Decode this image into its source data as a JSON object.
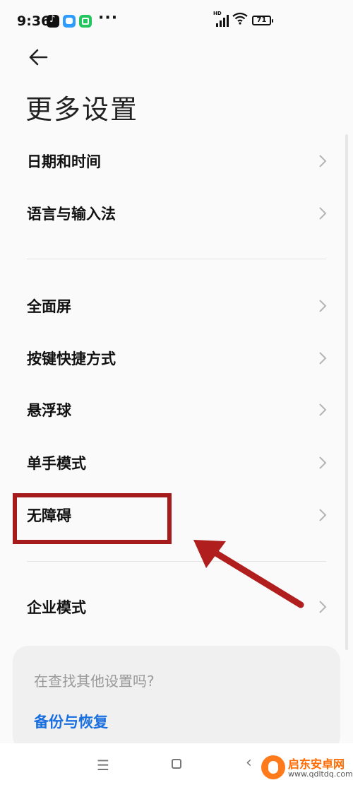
{
  "status_bar": {
    "time": "9:36",
    "more": "···",
    "network_badge": "HD",
    "battery": "71"
  },
  "header": {
    "title": "更多设置"
  },
  "settings": {
    "group1": [
      {
        "label": "日期和时间"
      },
      {
        "label": "语言与输入法"
      }
    ],
    "group2": [
      {
        "label": "全面屏"
      },
      {
        "label": "按键快捷方式"
      },
      {
        "label": "悬浮球"
      },
      {
        "label": "单手模式"
      },
      {
        "label": "无障碍"
      }
    ],
    "group3": [
      {
        "label": "企业模式"
      }
    ]
  },
  "search_card": {
    "question": "在查找其他设置吗?",
    "link": "备份与恢复"
  },
  "nav_bar": {
    "menu_glyph": "☰",
    "back_glyph": "‹"
  },
  "watermark": {
    "name": "启东安卓网",
    "url": "www.qdltdq.com"
  },
  "icons": {
    "back": "arrow-left-icon",
    "chevron": "chevron-right-icon",
    "annotation": "red-arrow-icon"
  },
  "colors": {
    "highlight": "#a51b1b",
    "link": "#1a6fe0",
    "watermark": "#ff6a00"
  }
}
